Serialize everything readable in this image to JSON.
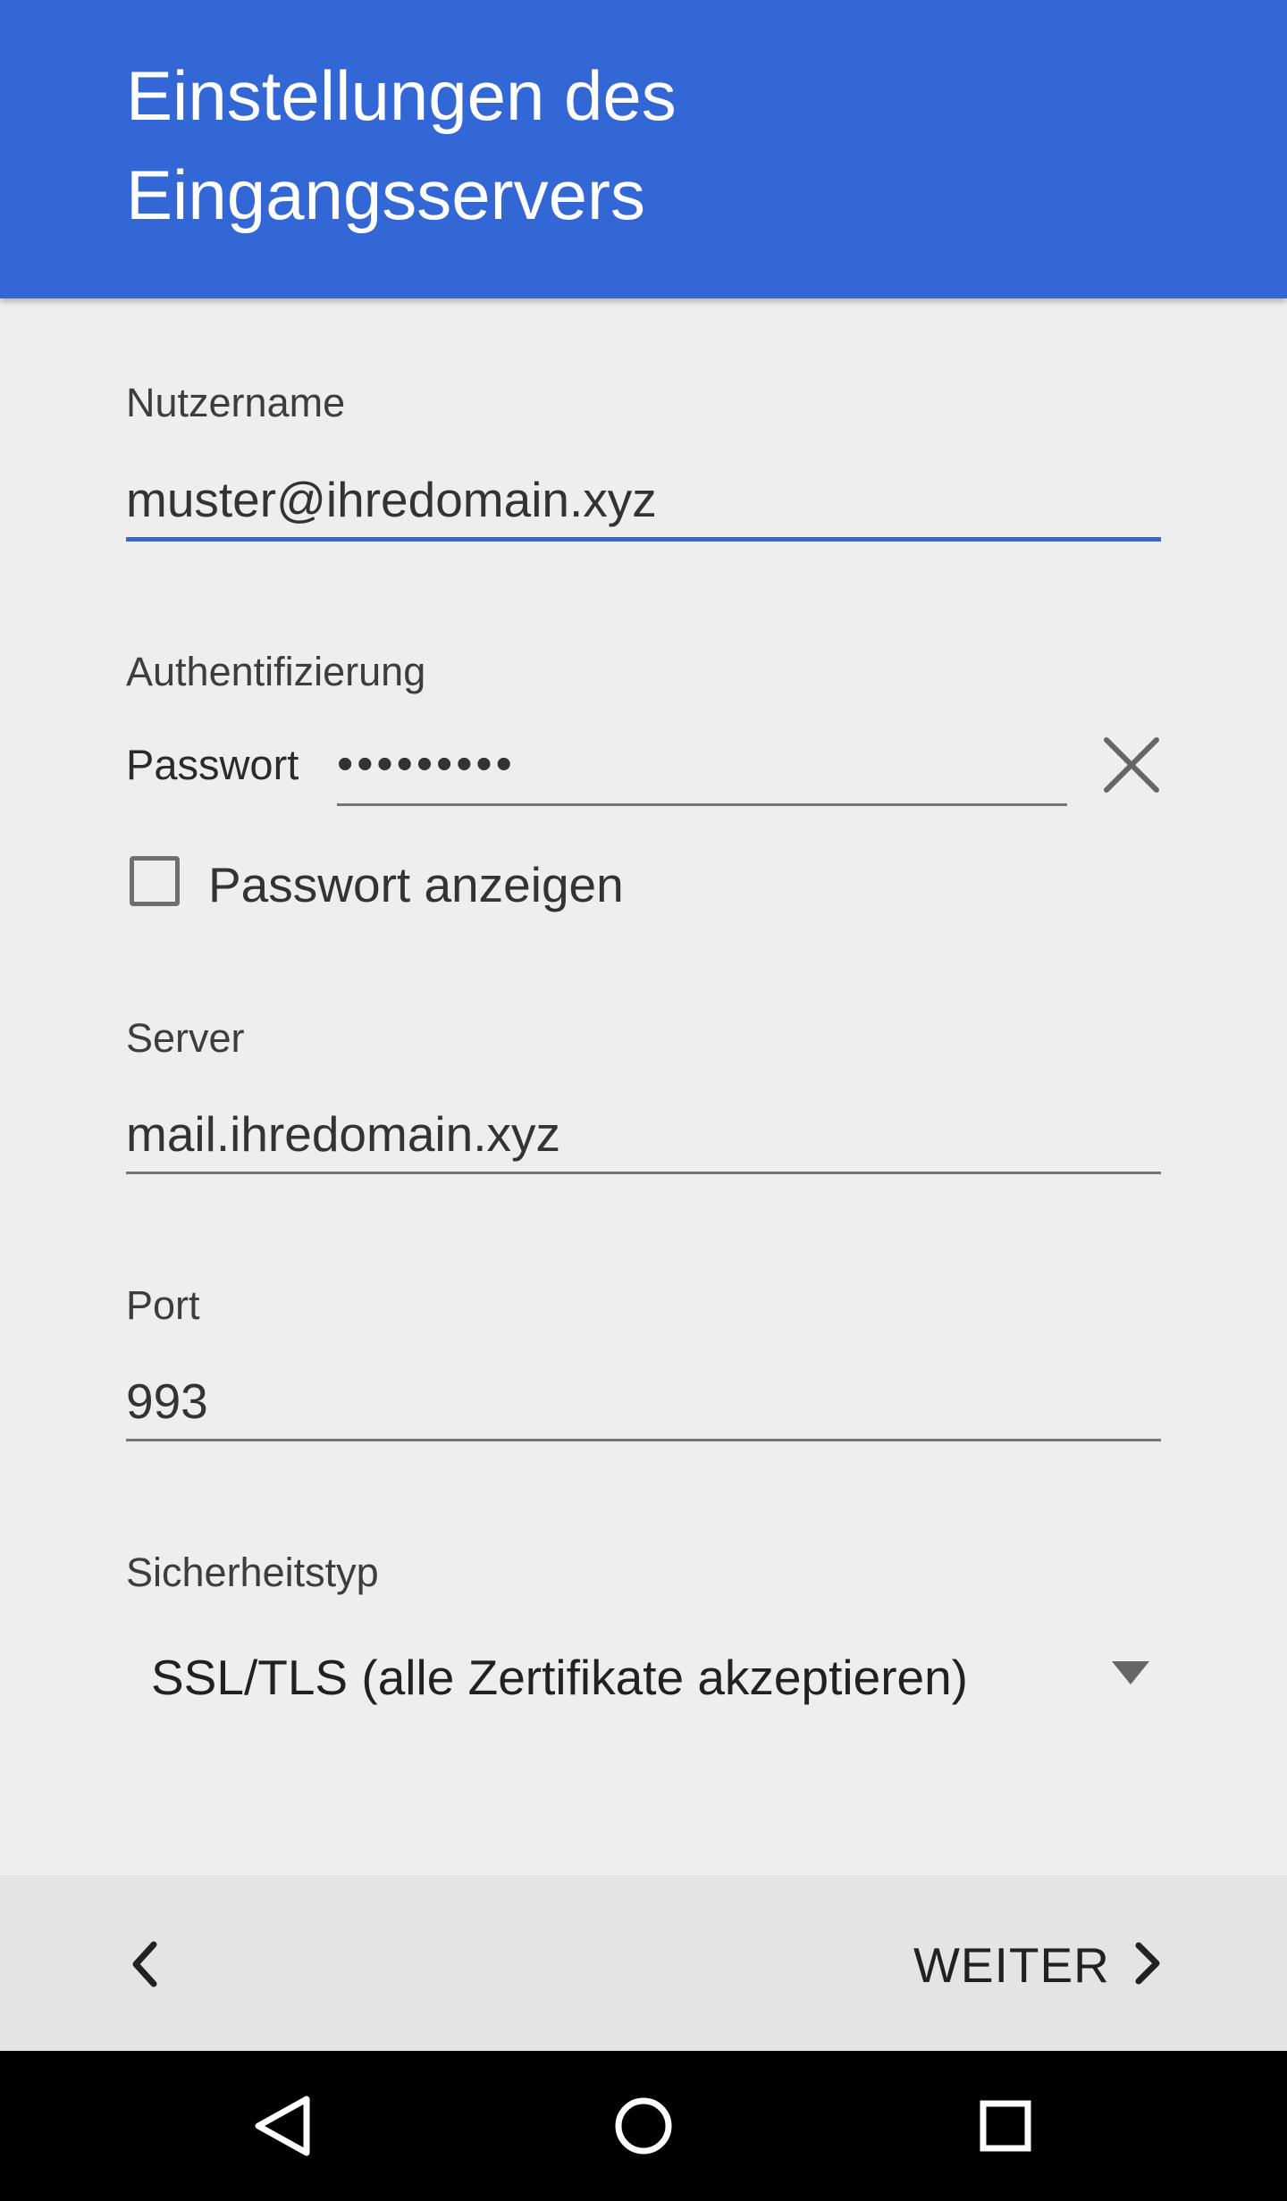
{
  "header": {
    "title": "Einstellungen des Eingangsservers"
  },
  "form": {
    "username": {
      "label": "Nutzername",
      "value": "muster@ihredomain.xyz"
    },
    "authentication": {
      "label": "Authentifizierung",
      "password_label": "Passwort",
      "password_value": "•••••••••",
      "show_password_label": "Passwort anzeigen",
      "show_password_checked": false
    },
    "server": {
      "label": "Server",
      "value": "mail.ihredomain.xyz"
    },
    "port": {
      "label": "Port",
      "value": "993"
    },
    "security": {
      "label": "Sicherheitstyp",
      "selected": "SSL/TLS (alle Zertifikate akzeptieren)"
    }
  },
  "footer": {
    "next_label": "WEITER"
  },
  "colors": {
    "accent": "#3367d6",
    "background": "#eeeeee",
    "footer": "#e2e4e6",
    "nav_bar": "#000000"
  },
  "icons": {
    "clear": "close-icon",
    "back": "chevron-left-icon",
    "next": "chevron-right-icon",
    "dropdown": "caret-down-icon",
    "nav": [
      "back-triangle-icon",
      "home-circle-icon",
      "recents-square-icon"
    ]
  }
}
